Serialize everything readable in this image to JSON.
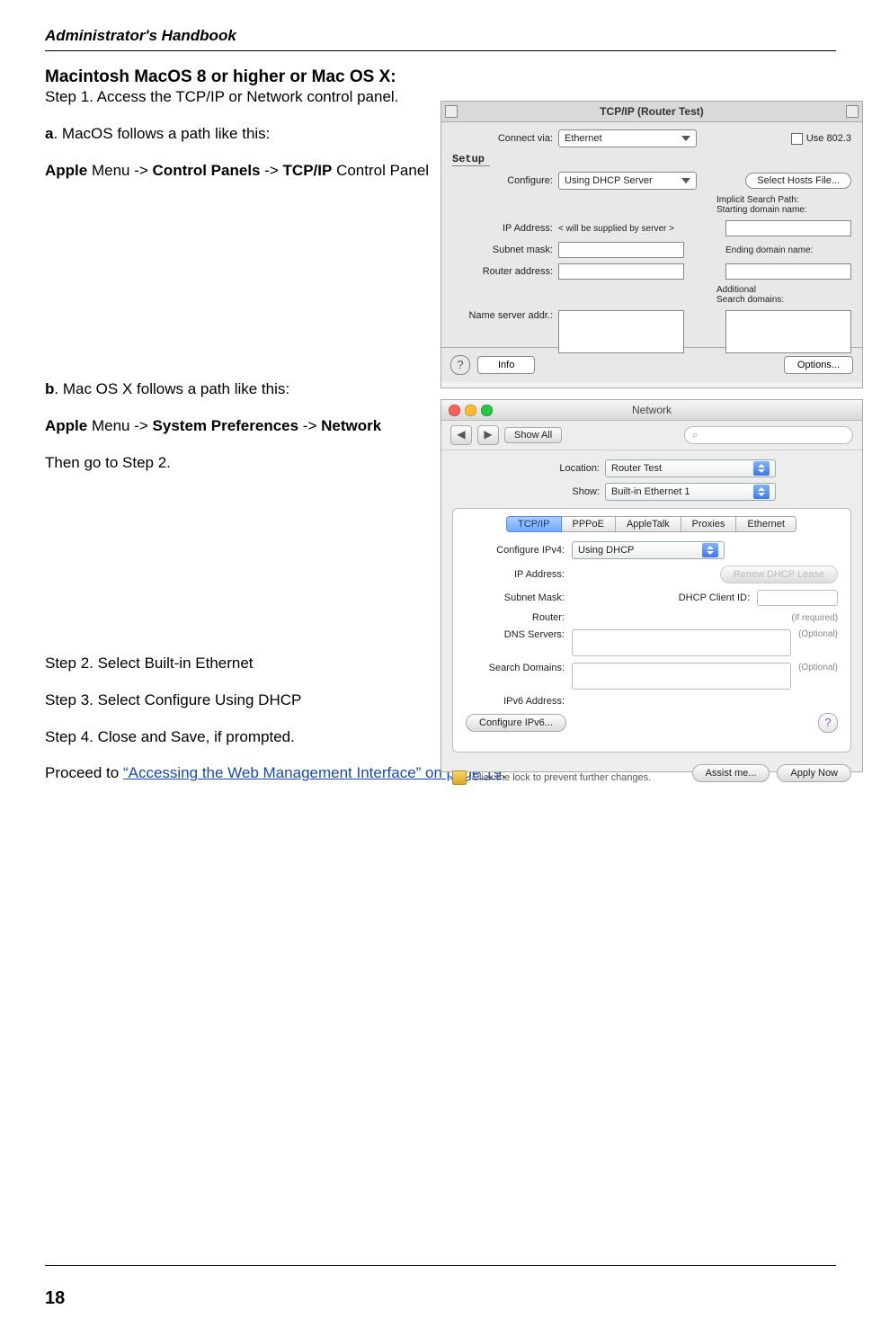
{
  "running_head": "Administrator's Handbook",
  "page_number": "18",
  "h1": "Macintosh MacOS 8 or higher or Mac OS X:",
  "step1": "Step 1. Access the TCP/IP or Network control panel.",
  "a_lead": "a",
  "a_rest": ". MacOS follows a path like this:",
  "a_path_apple": "Apple",
  "a_path_menu": " Menu -> ",
  "a_path_ctrlp": "Control Panels",
  "a_path_arrow2": " -> ",
  "a_path_tcpip": "TCP/IP",
  "a_path_tail": " Control Panel",
  "b_lead": "b",
  "b_rest": ". Mac OS X follows a path like this:",
  "b_path_apple": "Apple",
  "b_path_menu": " Menu -> ",
  "b_path_sysp": "System Preferences",
  "b_path_arrow2": " -> ",
  "b_path_net": "Network",
  "then": "Then go to Step 2.",
  "step2": "Step 2. Select Built-in Ethernet",
  "step3": "Step 3. Select Configure Using DHCP",
  "step4": "Step 4. Close and Save, if prompted.",
  "proceed_pre": "Proceed to ",
  "proceed_link": "“Accessing the Web Management Interface” on page 19",
  "proceed_post": ".",
  "macos9": {
    "title": "TCP/IP (Router Test)",
    "setup": "Setup",
    "connect_via_lbl": "Connect via:",
    "connect_via_val": "Ethernet",
    "use8023": "Use 802.3",
    "configure_lbl": "Configure:",
    "configure_val": "Using DHCP Server",
    "select_hosts": "Select Hosts File...",
    "implicit": "Implicit Search Path:",
    "starting": "Starting domain name:",
    "ip_lbl": "IP Address:",
    "ip_val": "< will be supplied by server >",
    "subnet_lbl": "Subnet mask:",
    "ending": "Ending domain name:",
    "router_lbl": "Router address:",
    "additional": "Additional",
    "search_domains": "Search domains:",
    "ns_lbl": "Name server addr.:",
    "info": "Info",
    "options": "Options..."
  },
  "macosx": {
    "title": "Network",
    "showall": "Show All",
    "location_lbl": "Location:",
    "location_val": "Router Test",
    "show_lbl": "Show:",
    "show_val": "Built-in Ethernet 1",
    "tabs": {
      "tcpip": "TCP/IP",
      "pppoe": "PPPoE",
      "atalk": "AppleTalk",
      "proxies": "Proxies",
      "eth": "Ethernet"
    },
    "cfg_lbl": "Configure IPv4:",
    "cfg_val": "Using DHCP",
    "renew": "Renew DHCP Lease",
    "ip_lbl": "IP Address:",
    "subnet_lbl": "Subnet Mask:",
    "dhcp_id": "DHCP Client ID:",
    "ifreq": "(If required)",
    "router_lbl": "Router:",
    "dns_lbl": "DNS Servers:",
    "sd_lbl": "Search Domains:",
    "optional": "(Optional)",
    "ipv6_lbl": "IPv6 Address:",
    "cfg6": "Configure IPv6...",
    "lock": "Click the lock to prevent further changes.",
    "assist": "Assist me...",
    "apply": "Apply Now"
  }
}
